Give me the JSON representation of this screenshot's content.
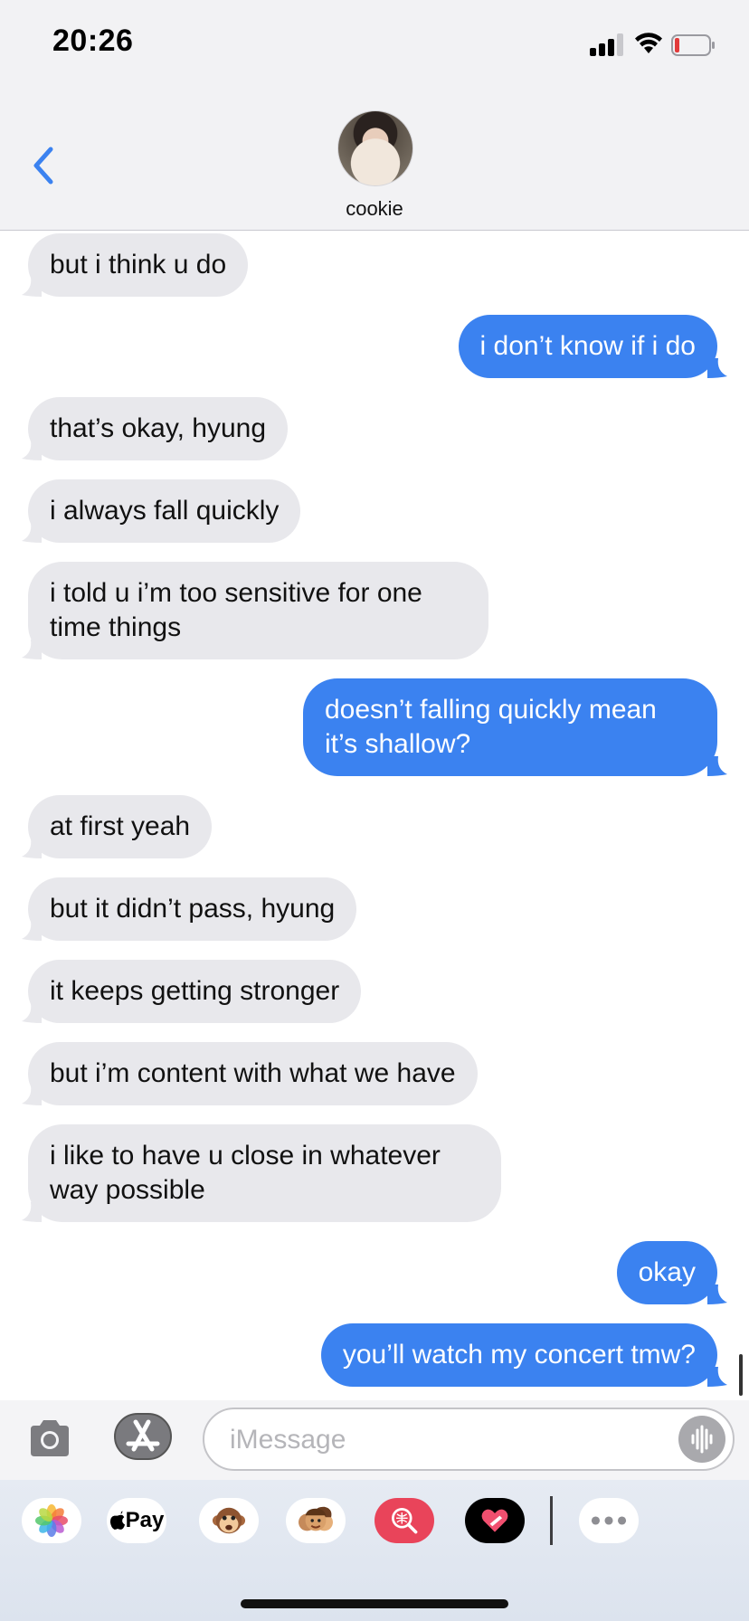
{
  "status_bar": {
    "time": "20:26"
  },
  "header": {
    "contact_name": "cookie"
  },
  "messages": [
    {
      "side": "in",
      "text": "but i think u do"
    },
    {
      "side": "out",
      "text": "i don’t know if i do"
    },
    {
      "side": "in",
      "text": "that’s okay, hyung"
    },
    {
      "side": "in",
      "text": "i always fall quickly"
    },
    {
      "side": "in",
      "text": "i told u i’m too sensitive for one time things"
    },
    {
      "side": "out",
      "text": "doesn’t falling quickly mean it’s shallow?"
    },
    {
      "side": "in",
      "text": "at first yeah"
    },
    {
      "side": "in",
      "text": "but it didn’t pass, hyung"
    },
    {
      "side": "in",
      "text": "it keeps getting stronger"
    },
    {
      "side": "in",
      "text": "but i’m content with what we have"
    },
    {
      "side": "in",
      "text": "i like to have u close in whatever way possible"
    },
    {
      "side": "out",
      "text": "okay"
    },
    {
      "side": "out",
      "text": "you’ll watch my concert tmw?"
    }
  ],
  "input": {
    "placeholder": "iMessage",
    "value": ""
  },
  "app_drawer": {
    "items": [
      "photos-app-icon",
      "apple-pay-icon",
      "animoji-icon",
      "memoji-stickers-icon",
      "images-search-icon",
      "digital-touch-icon",
      "more-apps-icon"
    ],
    "apple_pay_label": "Pay"
  },
  "colors": {
    "outgoing_bubble": "#3b82f0",
    "incoming_bubble": "#e8e8ec",
    "accent": "#3b82f0"
  }
}
